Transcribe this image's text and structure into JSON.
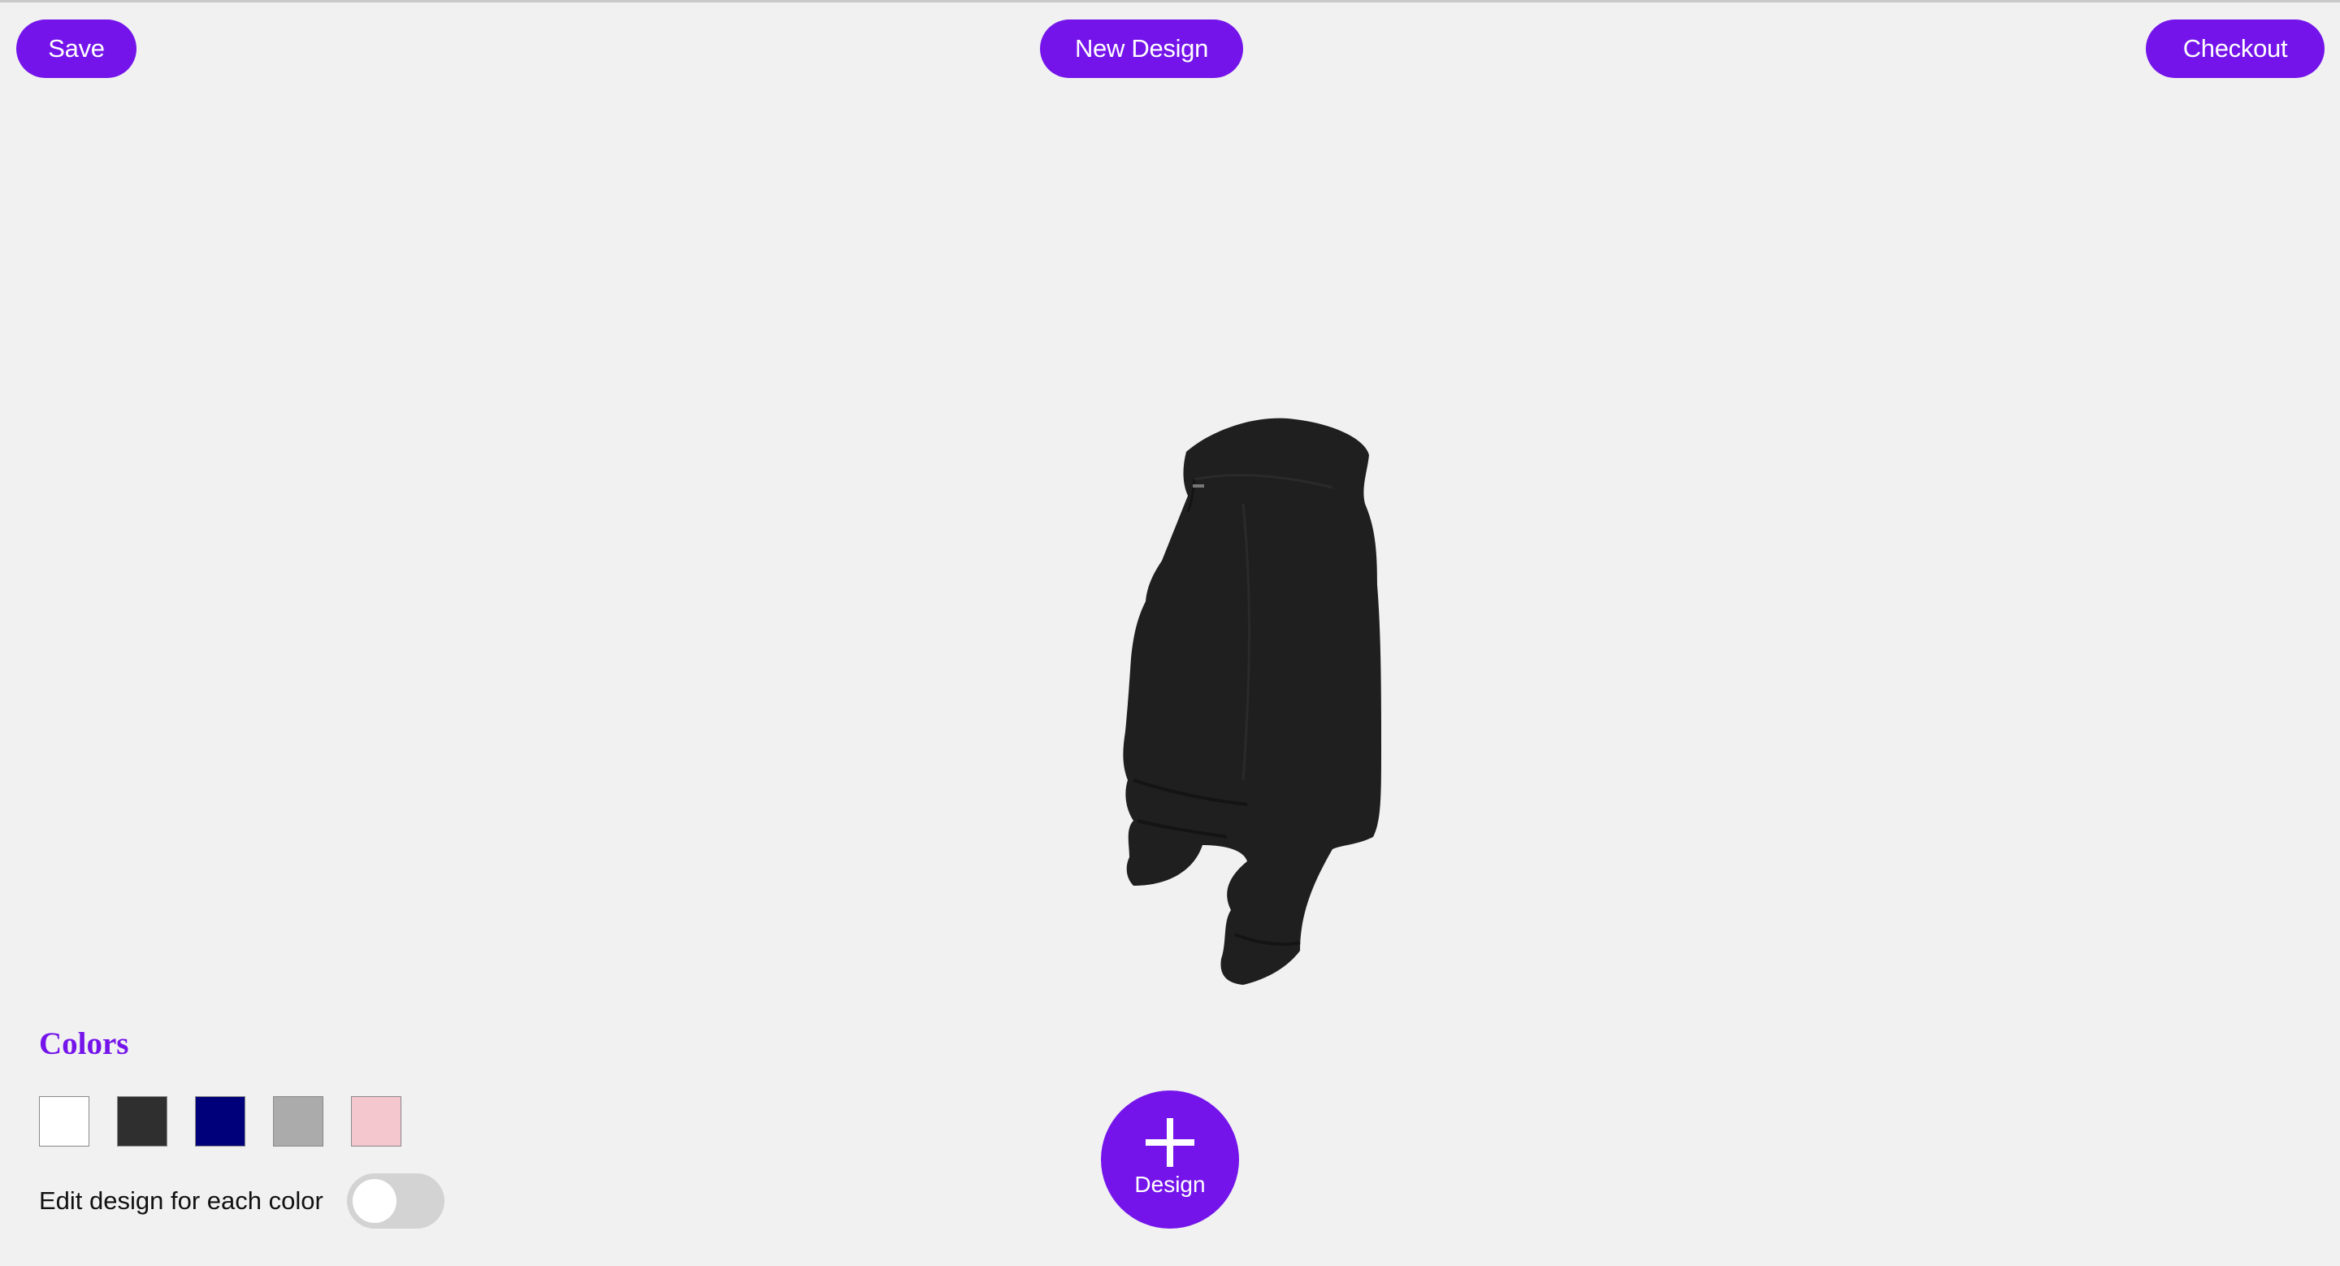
{
  "toolbar": {
    "save_label": "Save",
    "new_design_label": "New Design",
    "checkout_label": "Checkout"
  },
  "viewer": {
    "product_icon": "hoodie-3d-model",
    "product_color": "#1f1f1f"
  },
  "colors_panel": {
    "title": "Colors",
    "swatches": [
      {
        "color": "#ffffff"
      },
      {
        "color": "#2f2f2f"
      },
      {
        "color": "#00007a"
      },
      {
        "color": "#ababab"
      },
      {
        "color": "#f4c6cd"
      }
    ],
    "edit_each_label": "Edit design for each color",
    "edit_each_enabled": false
  },
  "design_button": {
    "label": "Design",
    "icon": "plus-icon"
  },
  "theme": {
    "accent": "#7414ea",
    "background": "#f1f1f1"
  }
}
